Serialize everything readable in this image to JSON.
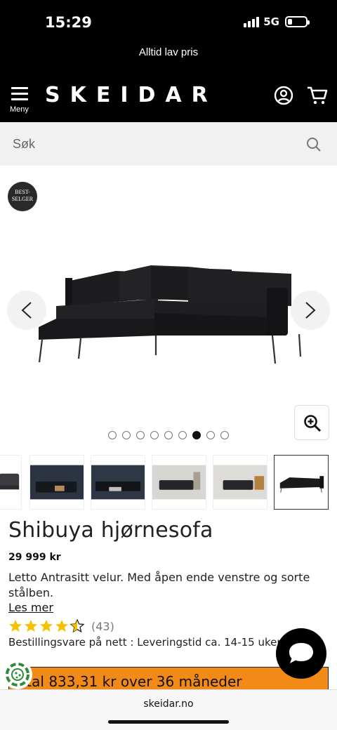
{
  "status_bar": {
    "time": "15:29",
    "network": "5G",
    "icons": [
      "signal-icon",
      "battery-icon"
    ]
  },
  "promo": {
    "text": "Alltid lav pris"
  },
  "header": {
    "menu_label": "Meny",
    "logo": "SKEIDAR",
    "icons": [
      "menu-icon",
      "account-icon",
      "cart-icon"
    ]
  },
  "search": {
    "placeholder": "Søk",
    "icon": "search-icon"
  },
  "gallery": {
    "badge": [
      "BEST-",
      "SELGER"
    ],
    "main_image": "corner-sofa-black",
    "dots_total": 9,
    "active_dot": 7,
    "icons": [
      "chevron-left-icon",
      "chevron-right-icon",
      "zoom-in-icon"
    ]
  },
  "thumbnails": [
    "sofa-side",
    "living-room-dark",
    "living-room-dark-2",
    "living-room-light",
    "living-room-light-2",
    "corner-sofa-black"
  ],
  "product": {
    "title": "Shibuya hjørnesofa",
    "price": "29 999 kr",
    "description": "Letto Antrasitt velur. Med åpen ende venstre og sorte stålben.",
    "read_more": "Les mer",
    "rating": 4.5,
    "review_count": "(43)",
    "delivery": "Bestillingsvare på nett : Leveringstid ca. 14-15 uker"
  },
  "finance": {
    "text": "etal 833,31 kr over 36 måneder"
  },
  "chat": {
    "icon": "chat-bubble-icon"
  },
  "browser": {
    "domain": "skeidar.no"
  },
  "colors": {
    "accent_orange": "#f28a17",
    "header_black": "#000000",
    "star_yellow": "#f5c200"
  }
}
